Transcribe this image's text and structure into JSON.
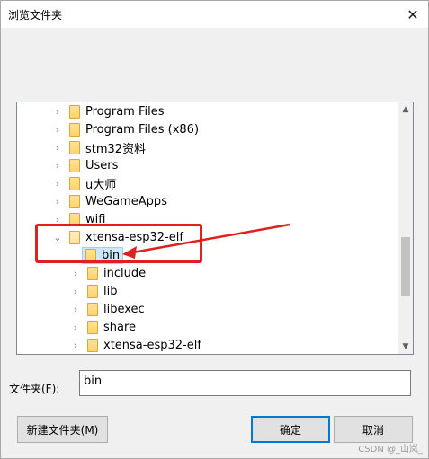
{
  "dialog": {
    "title": "浏览文件夹",
    "close_glyph": "✕"
  },
  "tree": {
    "items": [
      {
        "label": "Program Files",
        "expander": "›"
      },
      {
        "label": "Program Files (x86)",
        "expander": "›"
      },
      {
        "label": "stm32资料",
        "expander": "›"
      },
      {
        "label": "Users",
        "expander": "›"
      },
      {
        "label": "u大师",
        "expander": "›"
      },
      {
        "label": "WeGameApps",
        "expander": "›"
      },
      {
        "label": "wifi",
        "expander": "›"
      },
      {
        "label": "xtensa-esp32-elf",
        "expander": "⌄"
      },
      {
        "label": "bin",
        "expander": "",
        "selected": true
      },
      {
        "label": "include",
        "expander": "›"
      },
      {
        "label": "lib",
        "expander": "›"
      },
      {
        "label": "libexec",
        "expander": "›"
      },
      {
        "label": "share",
        "expander": "›"
      },
      {
        "label": "xtensa-esp32-elf",
        "expander": "›"
      }
    ],
    "scroll_up_glyph": "▲",
    "scroll_down_glyph": "▼"
  },
  "folder_field": {
    "label": "文件夹(F):",
    "value": "bin"
  },
  "buttons": {
    "new_folder": "新建文件夹(M)",
    "ok": "确定",
    "cancel": "取消"
  },
  "watermark": "CSDN @_山岚_",
  "colors": {
    "annotation_red": "#e02020",
    "selection": "#cce8ff",
    "primary_border": "#0078d7"
  }
}
